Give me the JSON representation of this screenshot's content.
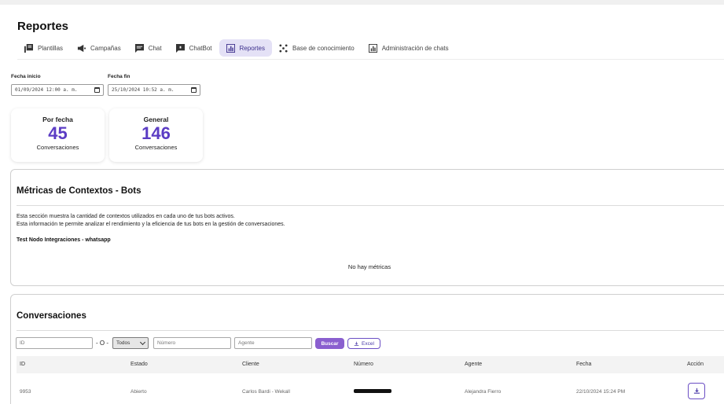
{
  "page": {
    "title": "Reportes"
  },
  "tabs": [
    {
      "label": "Plantillas",
      "icon": "templates-icon"
    },
    {
      "label": "Campañas",
      "icon": "megaphone-icon"
    },
    {
      "label": "Chat",
      "icon": "chat-icon"
    },
    {
      "label": "ChatBot",
      "icon": "chatbot-icon"
    },
    {
      "label": "Reportes",
      "icon": "chart-icon",
      "active": true
    },
    {
      "label": "Base de conocimiento",
      "icon": "knowledge-icon"
    },
    {
      "label": "Administración de chats",
      "icon": "admin-chart-icon"
    }
  ],
  "dates": {
    "start_label": "Fecha inicio",
    "start_value": "01/09/2024 12:00 a. m.",
    "end_label": "Fecha fin",
    "end_value": "25/10/2024 10:52 a. m."
  },
  "stats": [
    {
      "title": "Por fecha",
      "value": "45",
      "sub": "Conversaciones"
    },
    {
      "title": "General",
      "value": "146",
      "sub": "Conversaciones"
    }
  ],
  "metrics": {
    "title": "Métricas de Contextos - Bots",
    "desc_line1": "Esta sección muestra la cantidad de contextos utilizados en cada uno de tus bots activos.",
    "desc_line2": "Esta información te permite analizar el rendimiento y la eficiencia de tus bots en la gestión de conversaciones.",
    "bot_name": "Test Nodo Integraciones - whatsapp",
    "empty": "No hay métricas"
  },
  "conversations": {
    "title": "Conversaciones",
    "filters": {
      "id_placeholder": "ID",
      "separator": "- O -",
      "status_selected": "Todos",
      "number_placeholder": "Número",
      "agent_placeholder": "Agente",
      "search_label": "Buscar",
      "excel_label": "Excel"
    },
    "columns": [
      "ID",
      "Estado",
      "Cliente",
      "Número",
      "Agente",
      "Fecha",
      "Acción"
    ],
    "rows": [
      {
        "id": "9953",
        "estado": "Abierto",
        "cliente": "Carlos Bardi - Wekall",
        "numero": "",
        "agente": "Alejandra Fierro",
        "fecha": "22/10/2024 15:24 PM"
      }
    ]
  },
  "colors": {
    "accent": "#5b3cc4",
    "tab_active_bg": "#e4e1f6",
    "button_primary": "#8a5fcf"
  }
}
